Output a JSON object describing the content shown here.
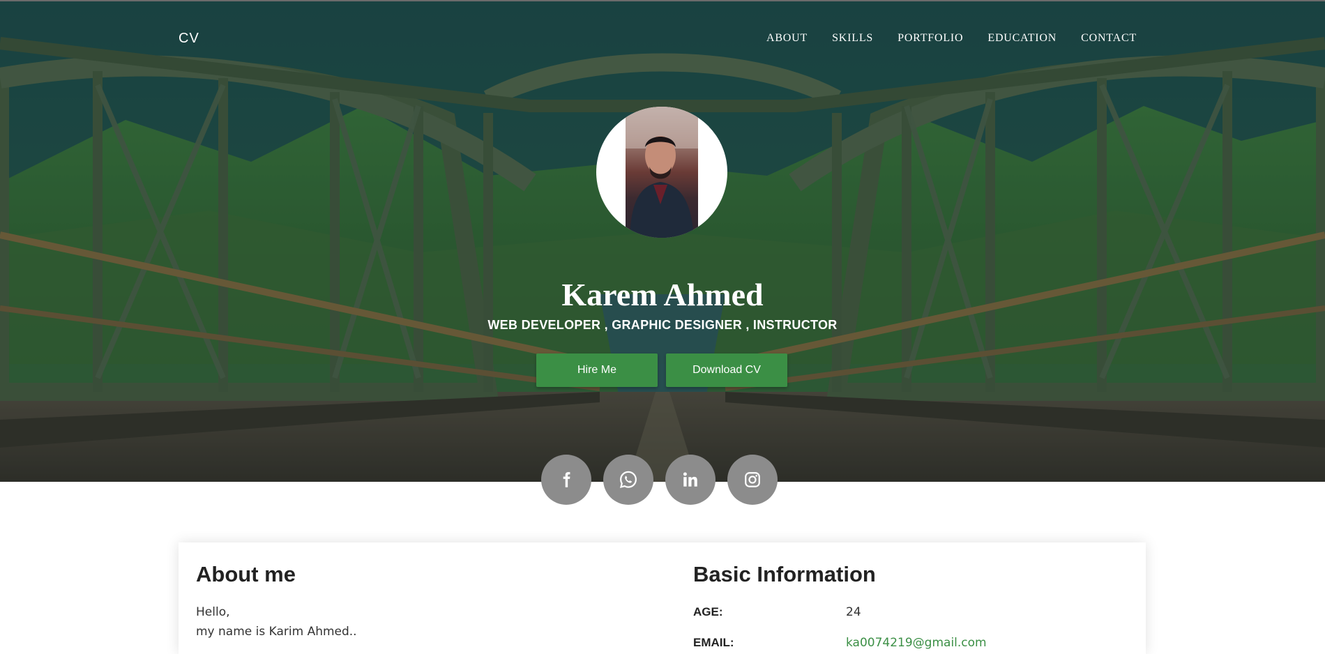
{
  "nav": {
    "brand": "CV",
    "items": [
      "ABOUT",
      "SKILLS",
      "PORTFOLIO",
      "EDUCATION",
      "CONTACT"
    ]
  },
  "hero": {
    "name": "Karem Ahmed",
    "roles": "WEB DEVELOPER , GRAPHIC DESIGNER , INSTRUCTOR",
    "hire_label": "Hire Me",
    "download_label": "Download CV"
  },
  "socials": [
    {
      "icon": "facebook-icon"
    },
    {
      "icon": "whatsapp-icon"
    },
    {
      "icon": "linkedin-icon"
    },
    {
      "icon": "instagram-icon"
    }
  ],
  "about": {
    "title": "About me",
    "lines": [
      "Hello,",
      "my name is Karim Ahmed.."
    ]
  },
  "basic_info": {
    "title": "Basic Information",
    "rows": [
      {
        "label": "AGE:",
        "value": "24"
      },
      {
        "label": "EMAIL:",
        "value": "ka0074219@gmail.com"
      }
    ]
  },
  "colors": {
    "accent": "#3b8f45",
    "social_bg": "#8c8c8c"
  }
}
